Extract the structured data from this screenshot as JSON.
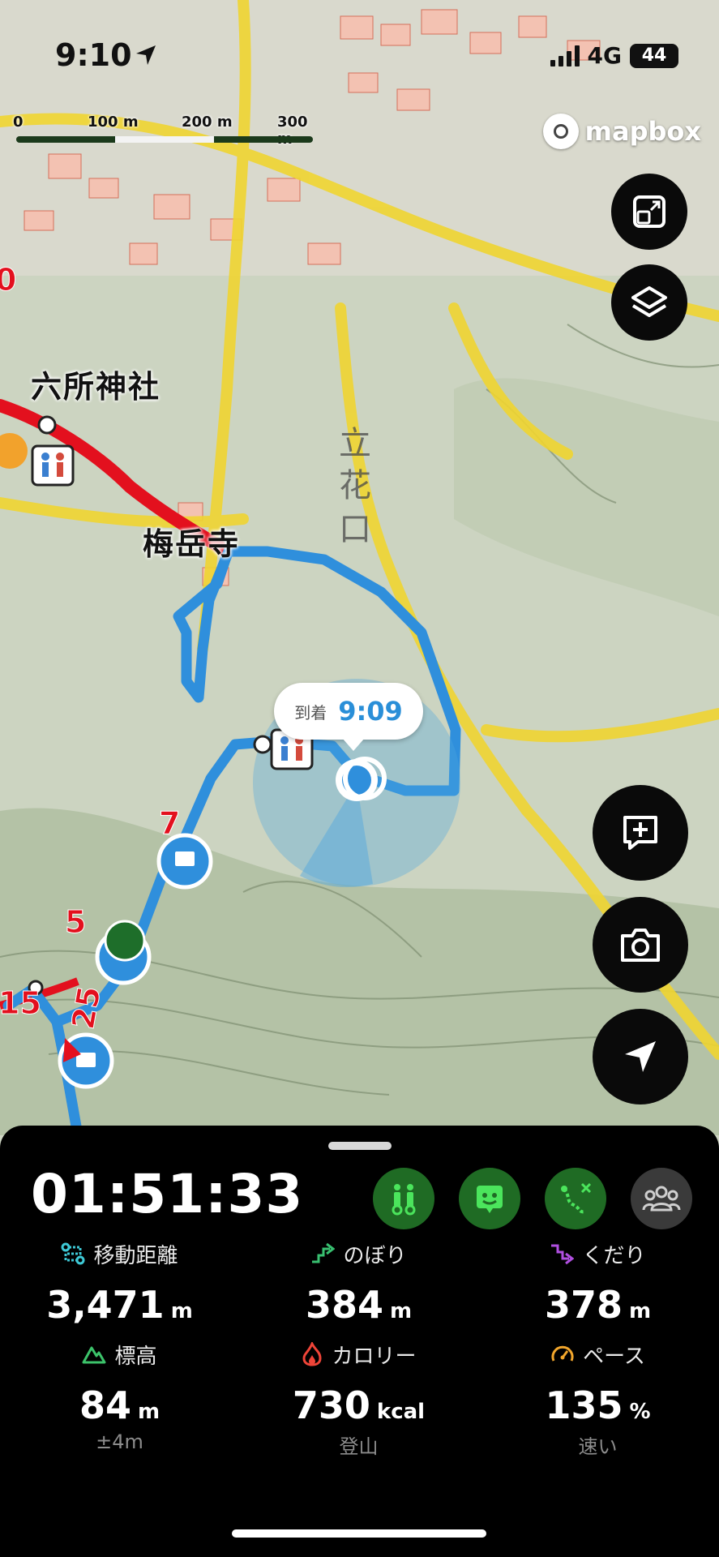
{
  "status_bar": {
    "time": "9:10",
    "network": "4G",
    "battery": "44"
  },
  "scale_bar": {
    "labels": [
      "0",
      "100 m",
      "200 m",
      "300 m"
    ]
  },
  "attribution": "mapbox",
  "map": {
    "place_labels": [
      "六所神社",
      "梅岳寺"
    ],
    "route_markers": [
      "7",
      "5",
      "15",
      "25",
      "0"
    ],
    "terrain_labels": [
      "立",
      "花",
      "口"
    ],
    "arrival_bubble": {
      "label": "到着",
      "time": "9:09"
    },
    "route_colors": {
      "planned": "#e3101e",
      "track": "#2f8fdc"
    }
  },
  "map_controls": [
    "fit-icon",
    "layers-icon",
    "add-note-icon",
    "camera-icon",
    "navigate-icon"
  ],
  "panel": {
    "elapsed": "01:51:33",
    "modes": [
      {
        "icon": "mountain-people-icon",
        "active": true
      },
      {
        "icon": "face-icon",
        "active": true
      },
      {
        "icon": "route-icon",
        "active": true
      },
      {
        "icon": "group-icon",
        "active": false
      }
    ],
    "stats": [
      {
        "label": "移動距離",
        "value": "3,471",
        "unit": "m",
        "icon": "distance-icon",
        "color": "#3ec9d6"
      },
      {
        "label": "のぼり",
        "value": "384",
        "unit": "m",
        "icon": "ascent-icon",
        "color": "#38c070"
      },
      {
        "label": "くだり",
        "value": "378",
        "unit": "m",
        "icon": "descent-icon",
        "color": "#b04fe0"
      },
      {
        "label": "標高",
        "value": "84",
        "unit": "m",
        "icon": "altitude-icon",
        "color": "#3cc36a"
      },
      {
        "label": "カロリー",
        "value": "730",
        "unit": "kcal",
        "icon": "calorie-icon",
        "color": "#ef4438"
      },
      {
        "label": "ペース",
        "value": "135",
        "unit": "%",
        "icon": "pace-icon",
        "color": "#f2a62c"
      }
    ],
    "subs": [
      "±4m",
      "登山",
      "速い"
    ]
  }
}
